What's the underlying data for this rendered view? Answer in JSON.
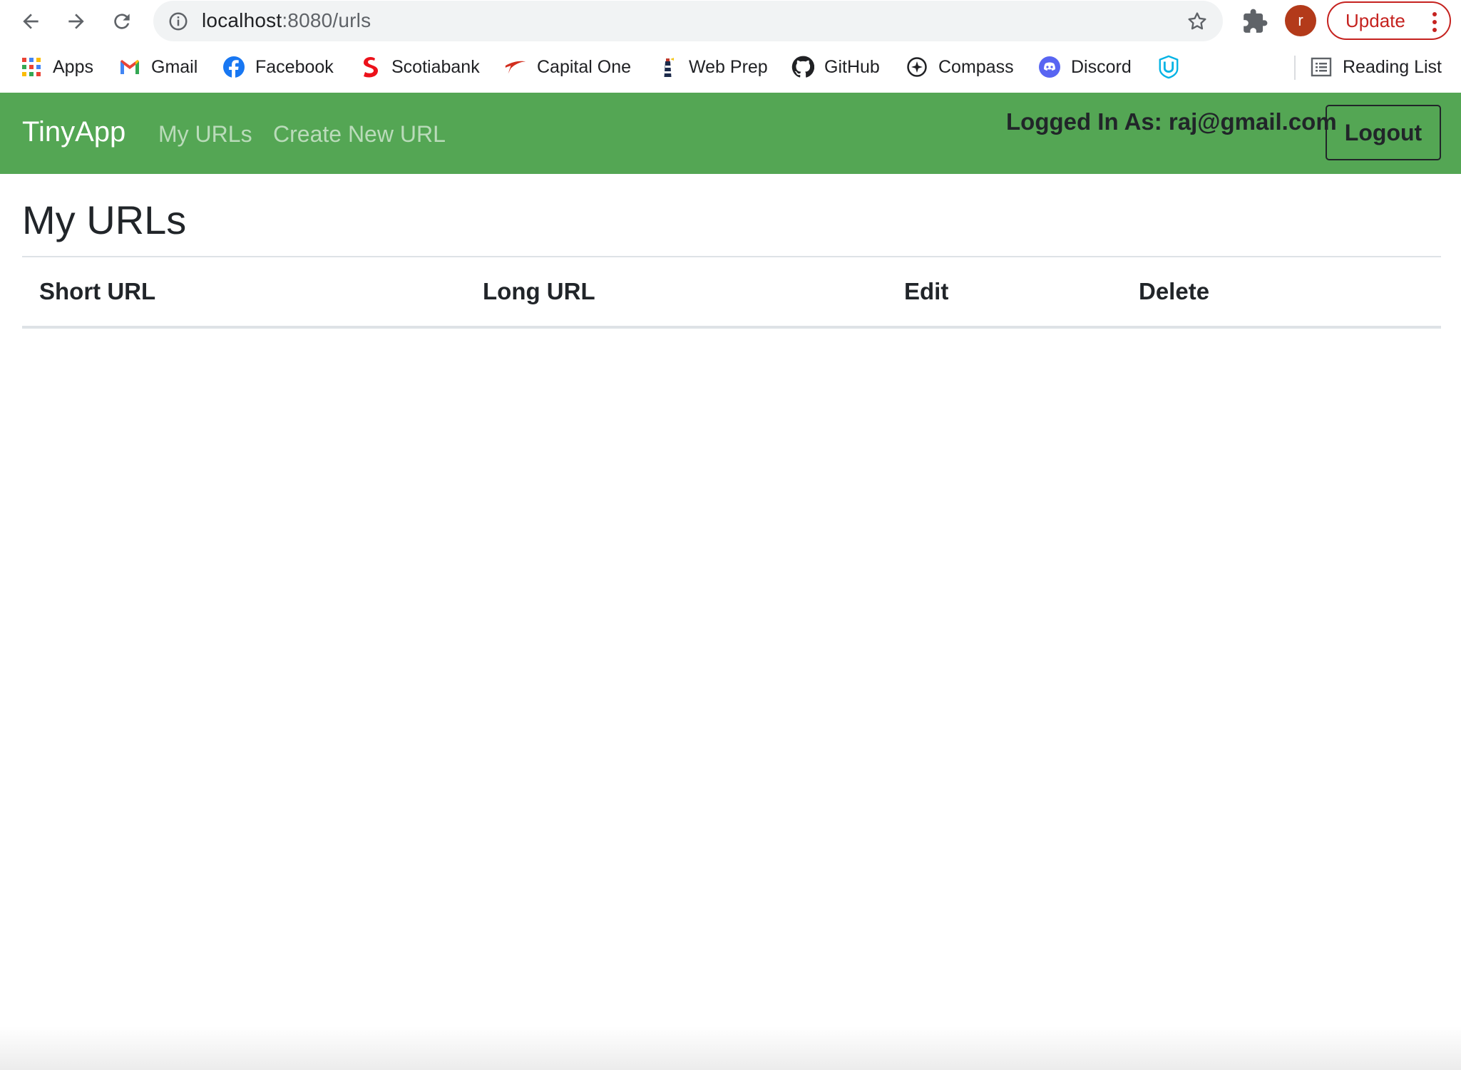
{
  "browser": {
    "url_host": "localhost",
    "url_rest": ":8080/urls",
    "avatar_letter": "r",
    "update_label": "Update"
  },
  "bookmarks": [
    {
      "label": "Apps",
      "icon": "apps-grid-icon"
    },
    {
      "label": "Gmail",
      "icon": "gmail-icon"
    },
    {
      "label": "Facebook",
      "icon": "facebook-icon"
    },
    {
      "label": "Scotiabank",
      "icon": "scotiabank-icon"
    },
    {
      "label": "Capital One",
      "icon": "capital-one-icon"
    },
    {
      "label": "Web Prep",
      "icon": "lighthouse-icon"
    },
    {
      "label": "GitHub",
      "icon": "github-icon"
    },
    {
      "label": "Compass",
      "icon": "compass-icon"
    },
    {
      "label": "Discord",
      "icon": "discord-icon"
    },
    {
      "label": "",
      "icon": "udacity-icon"
    }
  ],
  "reading_list": "Reading List",
  "navbar": {
    "brand": "TinyApp",
    "links": [
      "My URLs",
      "Create New URL"
    ],
    "logged_in": "Logged In As: raj@gmail.com",
    "logout_label": "Logout",
    "color": "#54a654"
  },
  "page": {
    "title": "My URLs"
  },
  "table": {
    "headers": [
      "Short URL",
      "Long URL",
      "Edit",
      "Delete"
    ],
    "rows": []
  }
}
